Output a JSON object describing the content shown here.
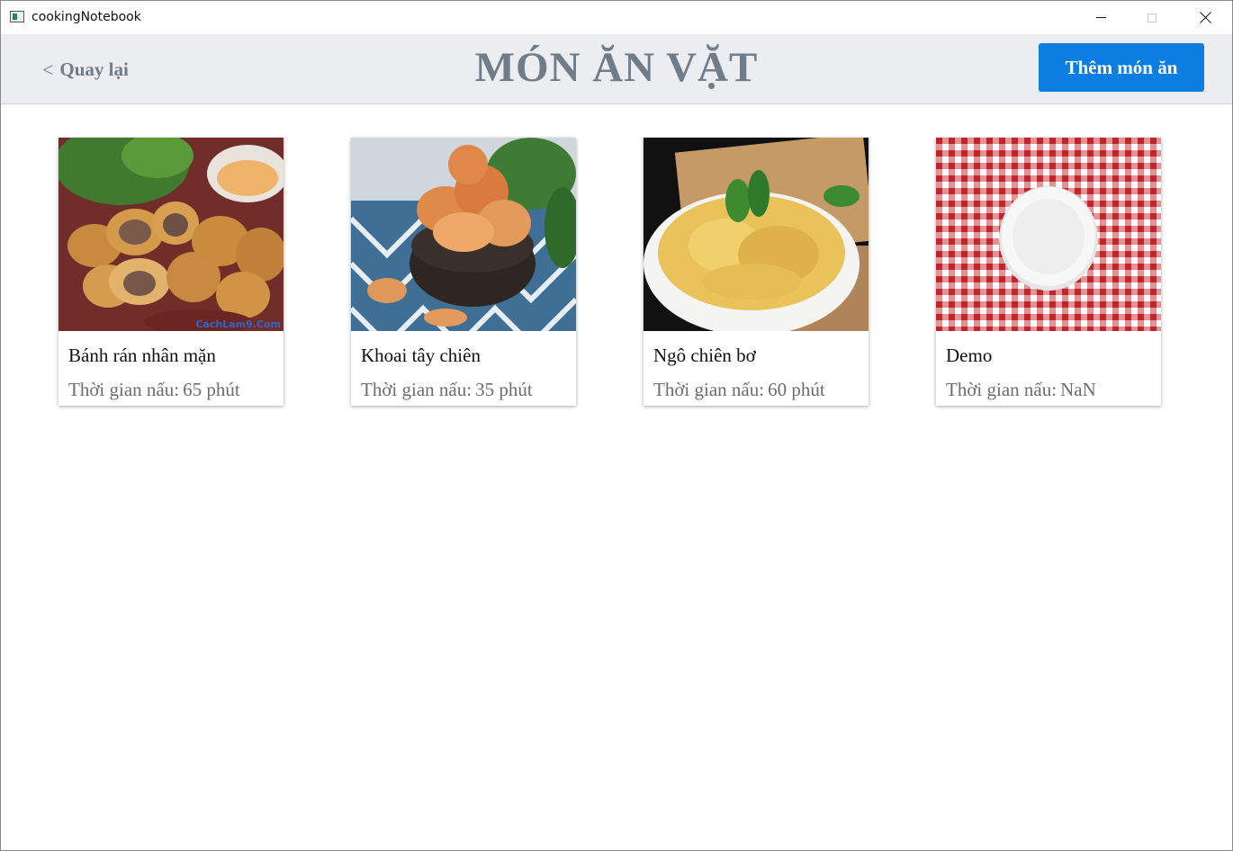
{
  "window": {
    "title": "cookingNotebook"
  },
  "header": {
    "back_chevron": "<",
    "back_label": "Quay lại",
    "title": "MÓN ĂN VẶT",
    "add_label": "Thêm món ăn"
  },
  "time_label": "Thời gian nấu:",
  "dishes": [
    {
      "name": "Bánh rán nhân mặn",
      "time": "65 phút",
      "image": "fried-pastry-photo",
      "watermark": "CachLam9.Com"
    },
    {
      "name": "Khoai tây chiên",
      "time": "35 phút",
      "image": "potato-chips-photo"
    },
    {
      "name": "Ngô chiên bơ",
      "time": "60 phút",
      "image": "fried-corn-photo"
    },
    {
      "name": "Demo",
      "time": "NaN",
      "image": "empty-plate-photo"
    }
  ],
  "colors": {
    "accent": "#0c7ee2",
    "header_bg": "#ecedf0",
    "title_text": "#6f7d8a",
    "muted_text": "#6d6d6d"
  }
}
